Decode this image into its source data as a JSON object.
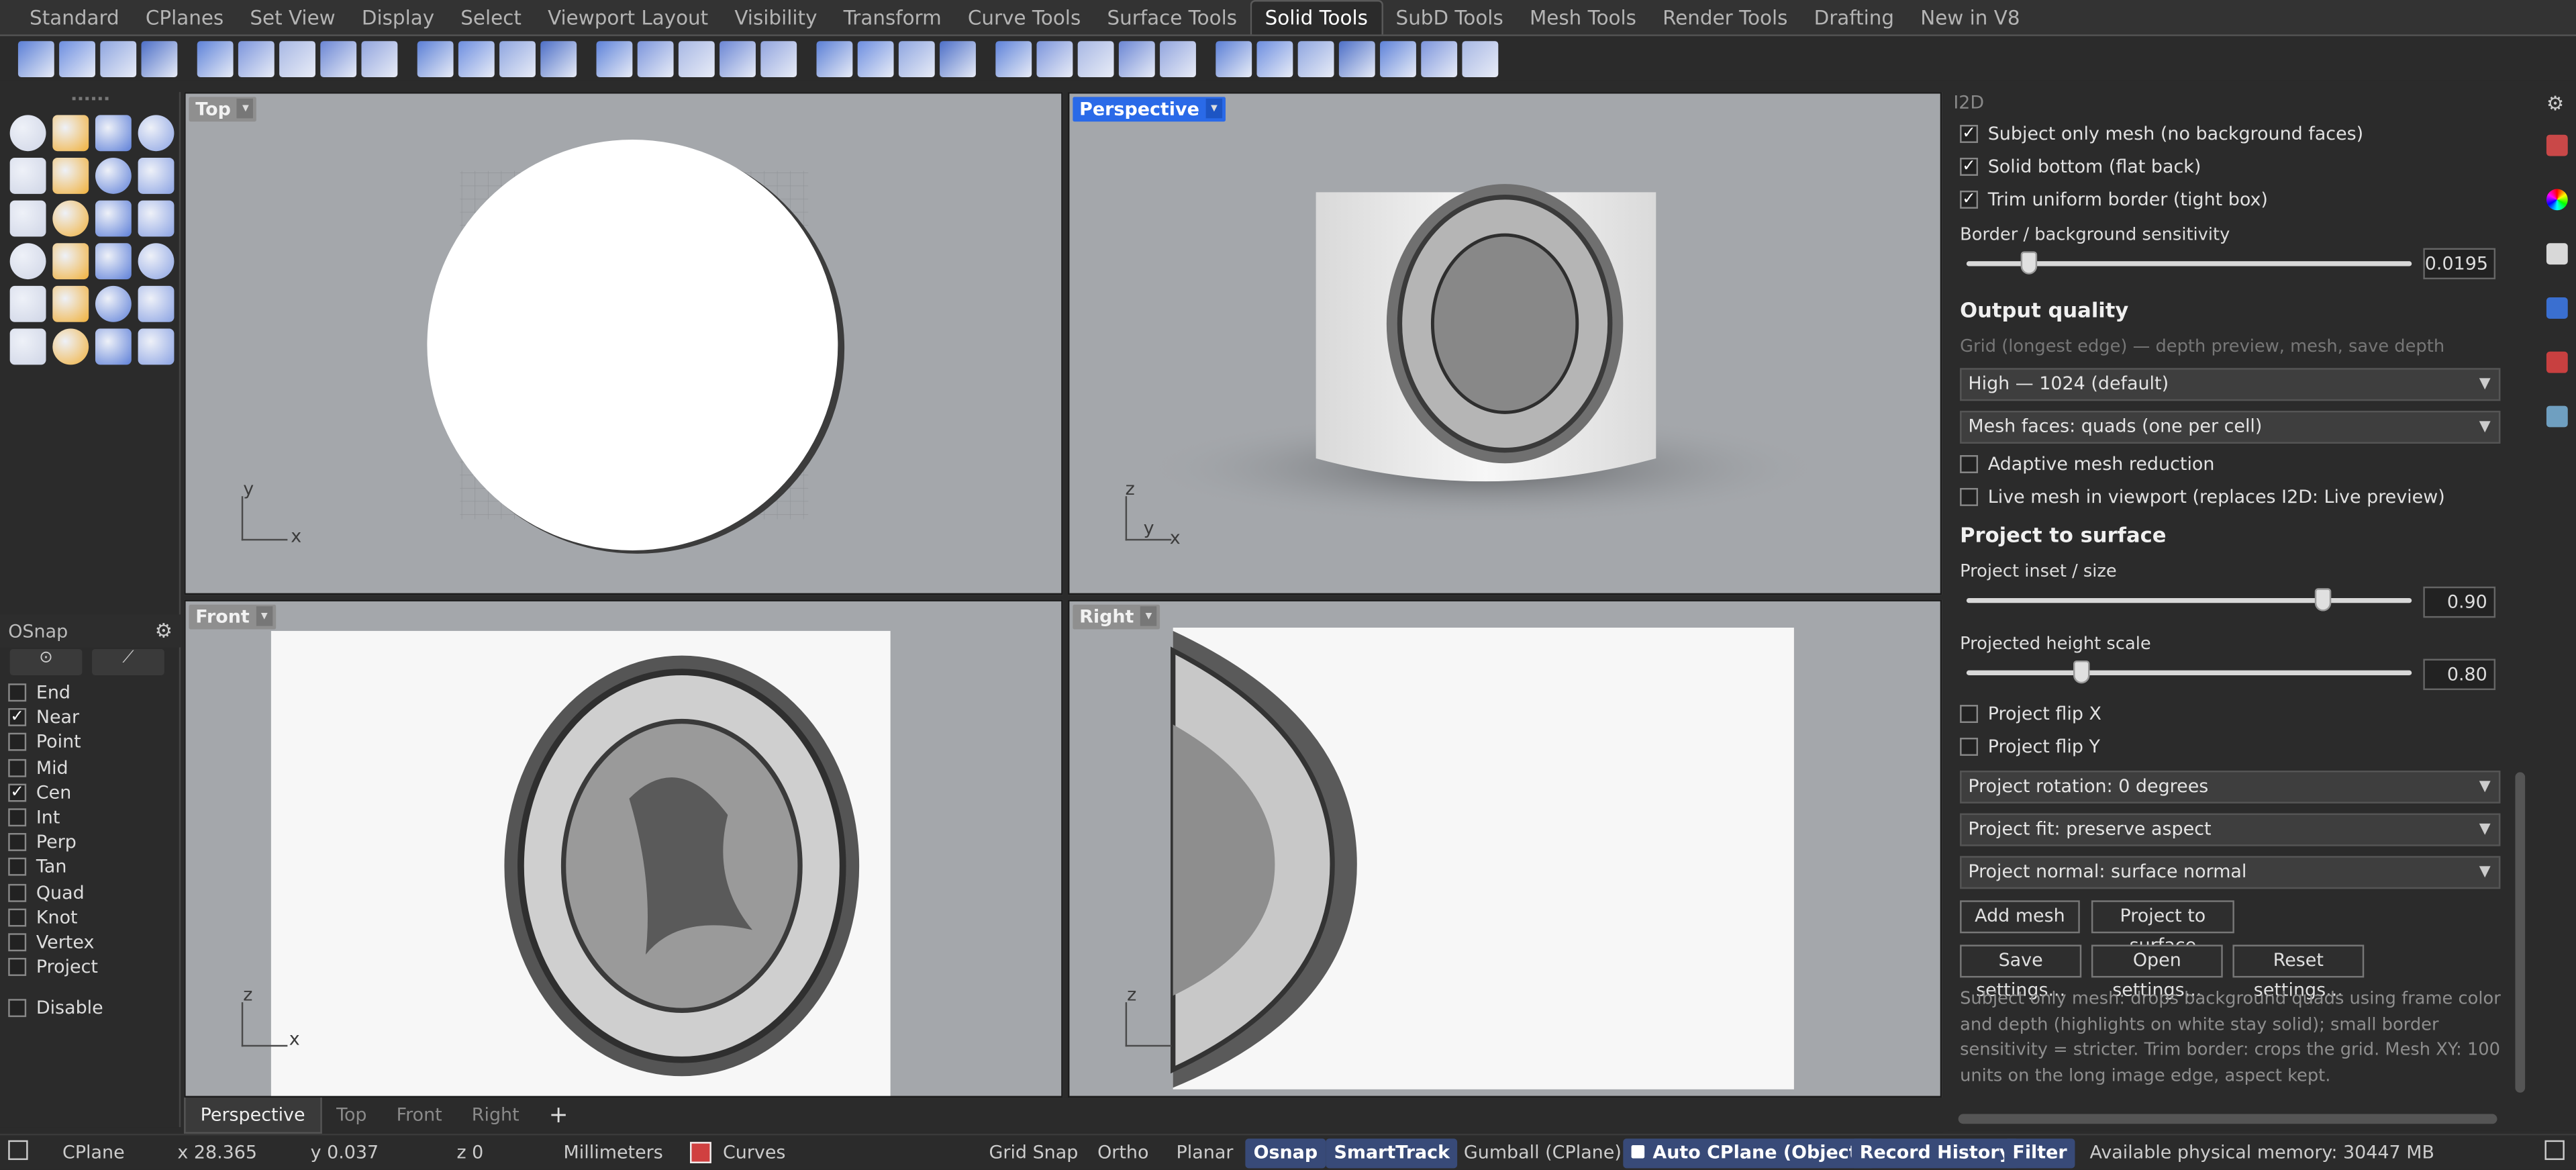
{
  "tabs": [
    "Standard",
    "CPlanes",
    "Set View",
    "Display",
    "Select",
    "Viewport Layout",
    "Visibility",
    "Transform",
    "Curve Tools",
    "Surface Tools",
    "Solid Tools",
    "SubD Tools",
    "Mesh Tools",
    "Render Tools",
    "Drafting",
    "New in V8"
  ],
  "active_tab": "Solid Tools",
  "viewports": {
    "top": "Top",
    "perspective": "Perspective",
    "front": "Front",
    "right": "Right"
  },
  "axes": {
    "x": "x",
    "y": "y",
    "z": "z"
  },
  "osnap": {
    "title": "OSnap",
    "items": [
      {
        "label": "End",
        "checked": false
      },
      {
        "label": "Near",
        "checked": true
      },
      {
        "label": "Point",
        "checked": false
      },
      {
        "label": "Mid",
        "checked": false
      },
      {
        "label": "Cen",
        "checked": true
      },
      {
        "label": "Int",
        "checked": false
      },
      {
        "label": "Perp",
        "checked": false
      },
      {
        "label": "Tan",
        "checked": false
      },
      {
        "label": "Quad",
        "checked": false
      },
      {
        "label": "Knot",
        "checked": false
      },
      {
        "label": "Vertex",
        "checked": false
      },
      {
        "label": "Project",
        "checked": false
      }
    ],
    "disable": "Disable"
  },
  "vp_tabs": [
    "Perspective",
    "Top",
    "Front",
    "Right"
  ],
  "vp_tab_add": "+",
  "status": {
    "cplane": "CPlane",
    "x": "x 28.365",
    "y": "y 0.037",
    "z": "z 0",
    "units": "Millimeters",
    "layer": "Curves",
    "grid_snap": "Grid Snap",
    "ortho": "Ortho",
    "planar": "Planar",
    "osnap": "Osnap",
    "smarttrack": "SmartTrack",
    "gumball": "Gumball (CPlane)",
    "autocplane": "Auto CPlane (Object)",
    "record": "Record History",
    "filter": "Filter",
    "memory": "Available physical memory: 30447 MB"
  },
  "panel": {
    "title": "I2D",
    "cb_subject": "Subject only mesh (no background faces)",
    "cb_solid": "Solid bottom (flat back)",
    "cb_trim": "Trim uniform border (tight box)",
    "border_label": "Border / background sensitivity",
    "border_value": "0.0195",
    "border_level": 0.14,
    "output_quality": "Output quality",
    "grid_hint": "Grid (longest edge) — depth preview, mesh, save depth",
    "quality_select": "High — 1024 (default)",
    "faces_select": "Mesh faces: quads (one per cell)",
    "cb_adaptive": "Adaptive mesh reduction",
    "cb_live": "Live mesh in viewport (replaces I2D: Live preview)",
    "project_section": "Project to surface",
    "inset_label": "Project inset / size",
    "inset_value": "0.90",
    "inset_level": 0.8,
    "height_label": "Projected height scale",
    "height_value": "0.80",
    "height_level": 0.26,
    "cb_flipx": "Project flip X",
    "cb_flipy": "Project flip Y",
    "rotation_select": "Project rotation: 0 degrees",
    "fit_select": "Project fit: preserve aspect",
    "normal_select": "Project normal: surface normal",
    "btn_add": "Add mesh",
    "btn_project": "Project to surface",
    "btn_save": "Save settings...",
    "btn_open": "Open settings...",
    "btn_reset": "Reset settings...",
    "description": "Subject only mesh: drops background quads using frame color and depth (highlights on white stay solid); small border sensitivity = stricter. Trim border: crops the grid. Mesh XY: 100 units on the long image edge, aspect kept."
  },
  "colors": {
    "accent": "#2a6ae8",
    "viewport_bg": "#a4a7ab",
    "button_active": "#384a78"
  }
}
